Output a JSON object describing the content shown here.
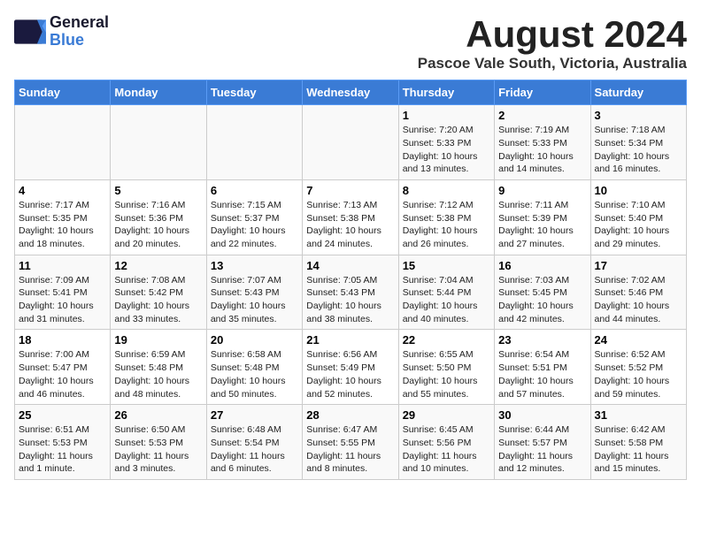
{
  "header": {
    "logo_line1": "General",
    "logo_line2": "Blue",
    "month_title": "August 2024",
    "subtitle": "Pascoe Vale South, Victoria, Australia"
  },
  "days_of_week": [
    "Sunday",
    "Monday",
    "Tuesday",
    "Wednesday",
    "Thursday",
    "Friday",
    "Saturday"
  ],
  "weeks": [
    [
      {
        "num": "",
        "sunrise": "",
        "sunset": "",
        "daylight": ""
      },
      {
        "num": "",
        "sunrise": "",
        "sunset": "",
        "daylight": ""
      },
      {
        "num": "",
        "sunrise": "",
        "sunset": "",
        "daylight": ""
      },
      {
        "num": "",
        "sunrise": "",
        "sunset": "",
        "daylight": ""
      },
      {
        "num": "1",
        "sunrise": "Sunrise: 7:20 AM",
        "sunset": "Sunset: 5:33 PM",
        "daylight": "Daylight: 10 hours and 13 minutes."
      },
      {
        "num": "2",
        "sunrise": "Sunrise: 7:19 AM",
        "sunset": "Sunset: 5:33 PM",
        "daylight": "Daylight: 10 hours and 14 minutes."
      },
      {
        "num": "3",
        "sunrise": "Sunrise: 7:18 AM",
        "sunset": "Sunset: 5:34 PM",
        "daylight": "Daylight: 10 hours and 16 minutes."
      }
    ],
    [
      {
        "num": "4",
        "sunrise": "Sunrise: 7:17 AM",
        "sunset": "Sunset: 5:35 PM",
        "daylight": "Daylight: 10 hours and 18 minutes."
      },
      {
        "num": "5",
        "sunrise": "Sunrise: 7:16 AM",
        "sunset": "Sunset: 5:36 PM",
        "daylight": "Daylight: 10 hours and 20 minutes."
      },
      {
        "num": "6",
        "sunrise": "Sunrise: 7:15 AM",
        "sunset": "Sunset: 5:37 PM",
        "daylight": "Daylight: 10 hours and 22 minutes."
      },
      {
        "num": "7",
        "sunrise": "Sunrise: 7:13 AM",
        "sunset": "Sunset: 5:38 PM",
        "daylight": "Daylight: 10 hours and 24 minutes."
      },
      {
        "num": "8",
        "sunrise": "Sunrise: 7:12 AM",
        "sunset": "Sunset: 5:38 PM",
        "daylight": "Daylight: 10 hours and 26 minutes."
      },
      {
        "num": "9",
        "sunrise": "Sunrise: 7:11 AM",
        "sunset": "Sunset: 5:39 PM",
        "daylight": "Daylight: 10 hours and 27 minutes."
      },
      {
        "num": "10",
        "sunrise": "Sunrise: 7:10 AM",
        "sunset": "Sunset: 5:40 PM",
        "daylight": "Daylight: 10 hours and 29 minutes."
      }
    ],
    [
      {
        "num": "11",
        "sunrise": "Sunrise: 7:09 AM",
        "sunset": "Sunset: 5:41 PM",
        "daylight": "Daylight: 10 hours and 31 minutes."
      },
      {
        "num": "12",
        "sunrise": "Sunrise: 7:08 AM",
        "sunset": "Sunset: 5:42 PM",
        "daylight": "Daylight: 10 hours and 33 minutes."
      },
      {
        "num": "13",
        "sunrise": "Sunrise: 7:07 AM",
        "sunset": "Sunset: 5:43 PM",
        "daylight": "Daylight: 10 hours and 35 minutes."
      },
      {
        "num": "14",
        "sunrise": "Sunrise: 7:05 AM",
        "sunset": "Sunset: 5:43 PM",
        "daylight": "Daylight: 10 hours and 38 minutes."
      },
      {
        "num": "15",
        "sunrise": "Sunrise: 7:04 AM",
        "sunset": "Sunset: 5:44 PM",
        "daylight": "Daylight: 10 hours and 40 minutes."
      },
      {
        "num": "16",
        "sunrise": "Sunrise: 7:03 AM",
        "sunset": "Sunset: 5:45 PM",
        "daylight": "Daylight: 10 hours and 42 minutes."
      },
      {
        "num": "17",
        "sunrise": "Sunrise: 7:02 AM",
        "sunset": "Sunset: 5:46 PM",
        "daylight": "Daylight: 10 hours and 44 minutes."
      }
    ],
    [
      {
        "num": "18",
        "sunrise": "Sunrise: 7:00 AM",
        "sunset": "Sunset: 5:47 PM",
        "daylight": "Daylight: 10 hours and 46 minutes."
      },
      {
        "num": "19",
        "sunrise": "Sunrise: 6:59 AM",
        "sunset": "Sunset: 5:48 PM",
        "daylight": "Daylight: 10 hours and 48 minutes."
      },
      {
        "num": "20",
        "sunrise": "Sunrise: 6:58 AM",
        "sunset": "Sunset: 5:48 PM",
        "daylight": "Daylight: 10 hours and 50 minutes."
      },
      {
        "num": "21",
        "sunrise": "Sunrise: 6:56 AM",
        "sunset": "Sunset: 5:49 PM",
        "daylight": "Daylight: 10 hours and 52 minutes."
      },
      {
        "num": "22",
        "sunrise": "Sunrise: 6:55 AM",
        "sunset": "Sunset: 5:50 PM",
        "daylight": "Daylight: 10 hours and 55 minutes."
      },
      {
        "num": "23",
        "sunrise": "Sunrise: 6:54 AM",
        "sunset": "Sunset: 5:51 PM",
        "daylight": "Daylight: 10 hours and 57 minutes."
      },
      {
        "num": "24",
        "sunrise": "Sunrise: 6:52 AM",
        "sunset": "Sunset: 5:52 PM",
        "daylight": "Daylight: 10 hours and 59 minutes."
      }
    ],
    [
      {
        "num": "25",
        "sunrise": "Sunrise: 6:51 AM",
        "sunset": "Sunset: 5:53 PM",
        "daylight": "Daylight: 11 hours and 1 minute."
      },
      {
        "num": "26",
        "sunrise": "Sunrise: 6:50 AM",
        "sunset": "Sunset: 5:53 PM",
        "daylight": "Daylight: 11 hours and 3 minutes."
      },
      {
        "num": "27",
        "sunrise": "Sunrise: 6:48 AM",
        "sunset": "Sunset: 5:54 PM",
        "daylight": "Daylight: 11 hours and 6 minutes."
      },
      {
        "num": "28",
        "sunrise": "Sunrise: 6:47 AM",
        "sunset": "Sunset: 5:55 PM",
        "daylight": "Daylight: 11 hours and 8 minutes."
      },
      {
        "num": "29",
        "sunrise": "Sunrise: 6:45 AM",
        "sunset": "Sunset: 5:56 PM",
        "daylight": "Daylight: 11 hours and 10 minutes."
      },
      {
        "num": "30",
        "sunrise": "Sunrise: 6:44 AM",
        "sunset": "Sunset: 5:57 PM",
        "daylight": "Daylight: 11 hours and 12 minutes."
      },
      {
        "num": "31",
        "sunrise": "Sunrise: 6:42 AM",
        "sunset": "Sunset: 5:58 PM",
        "daylight": "Daylight: 11 hours and 15 minutes."
      }
    ]
  ]
}
